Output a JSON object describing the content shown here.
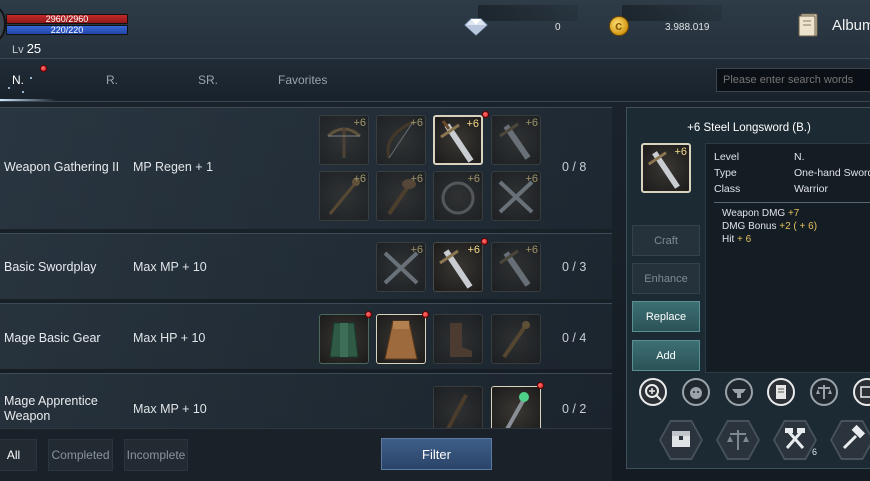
{
  "player": {
    "hp": "2960/2960",
    "mp": "220/220",
    "level_prefix": "Lv",
    "level": "25"
  },
  "currencies": {
    "gem_amount": "0",
    "gold_amount": "3.988.019"
  },
  "header": {
    "album_label": "Album"
  },
  "tabs": [
    {
      "label": "N.",
      "active": true
    },
    {
      "label": "R.",
      "active": false
    },
    {
      "label": "SR.",
      "active": false
    },
    {
      "label": "Favorites",
      "active": false
    }
  ],
  "search": {
    "placeholder": "Please enter search words"
  },
  "collections": [
    {
      "name": "Weapon Gathering II",
      "bonus": "MP Regen + 1",
      "progress": "0 / 8",
      "items": [
        "crossbow",
        "bow",
        "longsword",
        "sword",
        "staff",
        "club",
        "chakram",
        "dual-daggers"
      ]
    },
    {
      "name": "Basic Swordplay",
      "bonus": "Max MP + 10",
      "progress": "0 / 3",
      "items": [
        "dual-daggers",
        "longsword",
        "sword"
      ]
    },
    {
      "name": "Mage Basic Gear",
      "bonus": "Max HP + 10",
      "progress": "0 / 4",
      "items": [
        "robe",
        "cloak",
        "boots",
        "staff"
      ]
    },
    {
      "name": "Mage Apprentice Weapon",
      "bonus": "Max MP + 10",
      "progress": "0 / 2",
      "items": [
        "staff",
        "wand"
      ]
    }
  ],
  "item_plus": "+6",
  "filters": {
    "all": "All",
    "completed": "Completed",
    "incomplete": "Incomplete",
    "filter_button": "Filter"
  },
  "detail": {
    "title": "+6 Steel Longsword (B.)",
    "stats": [
      {
        "label": "Level",
        "value": "N."
      },
      {
        "label": "Type",
        "value": "One-hand Sword"
      },
      {
        "label": "Class",
        "value": "Warrior"
      }
    ],
    "bonuses": [
      {
        "label": "Weapon DMG",
        "value": "+7"
      },
      {
        "label": "DMG Bonus",
        "value": "+2 ( + 6)"
      },
      {
        "label": "Hit",
        "value": "+ 6"
      }
    ],
    "buttons": {
      "craft": "Craft",
      "enhance": "Enhance",
      "replace": "Replace",
      "add": "Add"
    },
    "hex_badge": "6"
  }
}
